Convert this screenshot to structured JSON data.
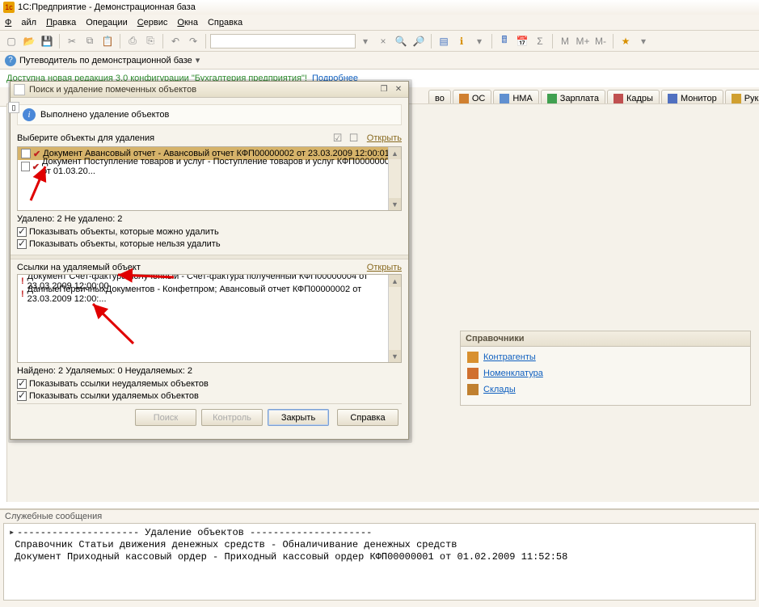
{
  "app_title": "1С:Предприятие - Демонстрационная база",
  "menu": {
    "file": "Файл",
    "edit": "Правка",
    "ops": "Операции",
    "svc": "Сервис",
    "win": "Окна",
    "help": "Справка"
  },
  "guide_label": "Путеводитель по демонстрационной базе",
  "notice_text": "Доступна новая редакция 3.0 конфигурации \"Бухгалтерия предприятия\"!",
  "notice_link": "Подробнее",
  "tabs": {
    "t1": "во",
    "os": "ОС",
    "nma": "НМА",
    "zarp": "Зарплата",
    "kadry": "Кадры",
    "mon": "Монитор",
    "ruk": "Руководителю"
  },
  "side": {
    "header": "Справочники",
    "items": [
      {
        "label": "Контрагенты"
      },
      {
        "label": "Номенклатура"
      },
      {
        "label": "Склады"
      }
    ]
  },
  "dialog": {
    "title": "Поиск и удаление помеченных объектов",
    "info": "Выполнено удаление объектов",
    "select_label": "Выберите объекты для удаления",
    "open": "Открыть",
    "items": [
      "Документ Авансовый отчет - Авансовый отчет КФП00000002 от 23.03.2009 12:00:01",
      "Документ Поступление товаров и услуг - Поступление товаров и услуг КФП00000009 от 01.03.20..."
    ],
    "del_stat": "Удалено: 2  Не удалено: 2",
    "chk1": "Показывать объекты, которые можно удалить",
    "chk2": "Показывать объекты, которые нельзя удалить",
    "refs_label": "Ссылки на удаляемый объект",
    "refs": [
      "Документ Счет-фактура полученный - Счет-фактура полученный КФП00000004 от 23.03.2009 12:00:00",
      "ДанныеПервичныхДокументов  - Конфетпром; Авансовый отчет КФП00000002 от 23.03.2009 12:00:..."
    ],
    "found_stat": "Найдено: 2  Удаляемых: 0  Неудаляемых: 2",
    "chk3": "Показывать ссылки неудаляемых объектов",
    "chk4": "Показывать ссылки удаляемых объектов",
    "btn_search": "Поиск",
    "btn_ctrl": "Контроль",
    "btn_close": "Закрыть",
    "btn_help": "Справка"
  },
  "messages": {
    "title": "Служебные сообщения",
    "lines": [
      "--------------------- Удаление объектов ---------------------",
      "Справочник Статьи движения денежных средств - Обналичивание денежных средств",
      "Документ Приходный кассовый ордер - Приходный кассовый ордер КФП00000001 от 01.02.2009 11:52:58"
    ]
  }
}
